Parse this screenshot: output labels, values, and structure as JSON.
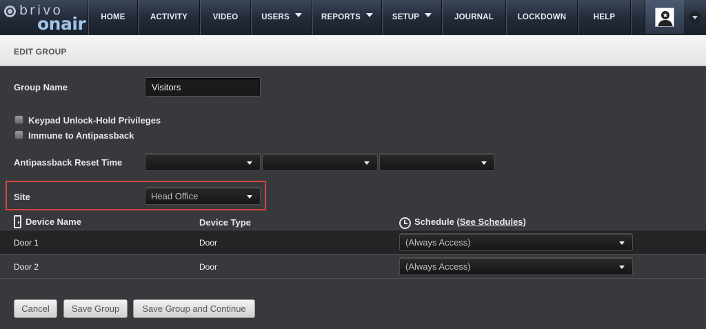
{
  "brand": {
    "line1": "brivo",
    "line2": "onair"
  },
  "nav": {
    "items": [
      {
        "label": "HOME",
        "dropdown": false
      },
      {
        "label": "ACTIVITY",
        "dropdown": false
      },
      {
        "label": "VIDEO",
        "dropdown": false
      },
      {
        "label": "USERS",
        "dropdown": true
      },
      {
        "label": "REPORTS",
        "dropdown": true
      },
      {
        "label": "SETUP",
        "dropdown": true
      },
      {
        "label": "JOURNAL",
        "dropdown": false
      },
      {
        "label": "LOCKDOWN",
        "dropdown": false
      },
      {
        "label": "HELP",
        "dropdown": false
      }
    ],
    "avatar_icon": "user-avatar-icon",
    "user_menu_icon": "chevron-down-icon"
  },
  "page": {
    "title": "EDIT GROUP"
  },
  "form": {
    "group_name_label": "Group Name",
    "group_name_value": "Visitors",
    "keypad_label": "Keypad Unlock-Hold Privileges",
    "immune_label": "Immune to Antipassback",
    "antipassback_label": "Antipassback Reset Time",
    "antipassback_values": [
      "",
      "",
      ""
    ],
    "site_label": "Site",
    "site_value": "Head Office"
  },
  "devices": {
    "headers": {
      "name": "Device Name",
      "type": "Device Type",
      "schedule": "Schedule",
      "schedule_open": "(",
      "schedule_link": "See Schedules",
      "schedule_close": ")"
    },
    "rows": [
      {
        "name": "Door 1",
        "type": "Door",
        "schedule": "(Always Access)"
      },
      {
        "name": "Door 2",
        "type": "Door",
        "schedule": "(Always Access)"
      }
    ]
  },
  "buttons": {
    "cancel": "Cancel",
    "save": "Save Group",
    "save_continue": "Save Group and Continue"
  },
  "colors": {
    "highlight": "#d9453d",
    "nav_bg": "#232b38",
    "body_bg": "#37393c"
  }
}
